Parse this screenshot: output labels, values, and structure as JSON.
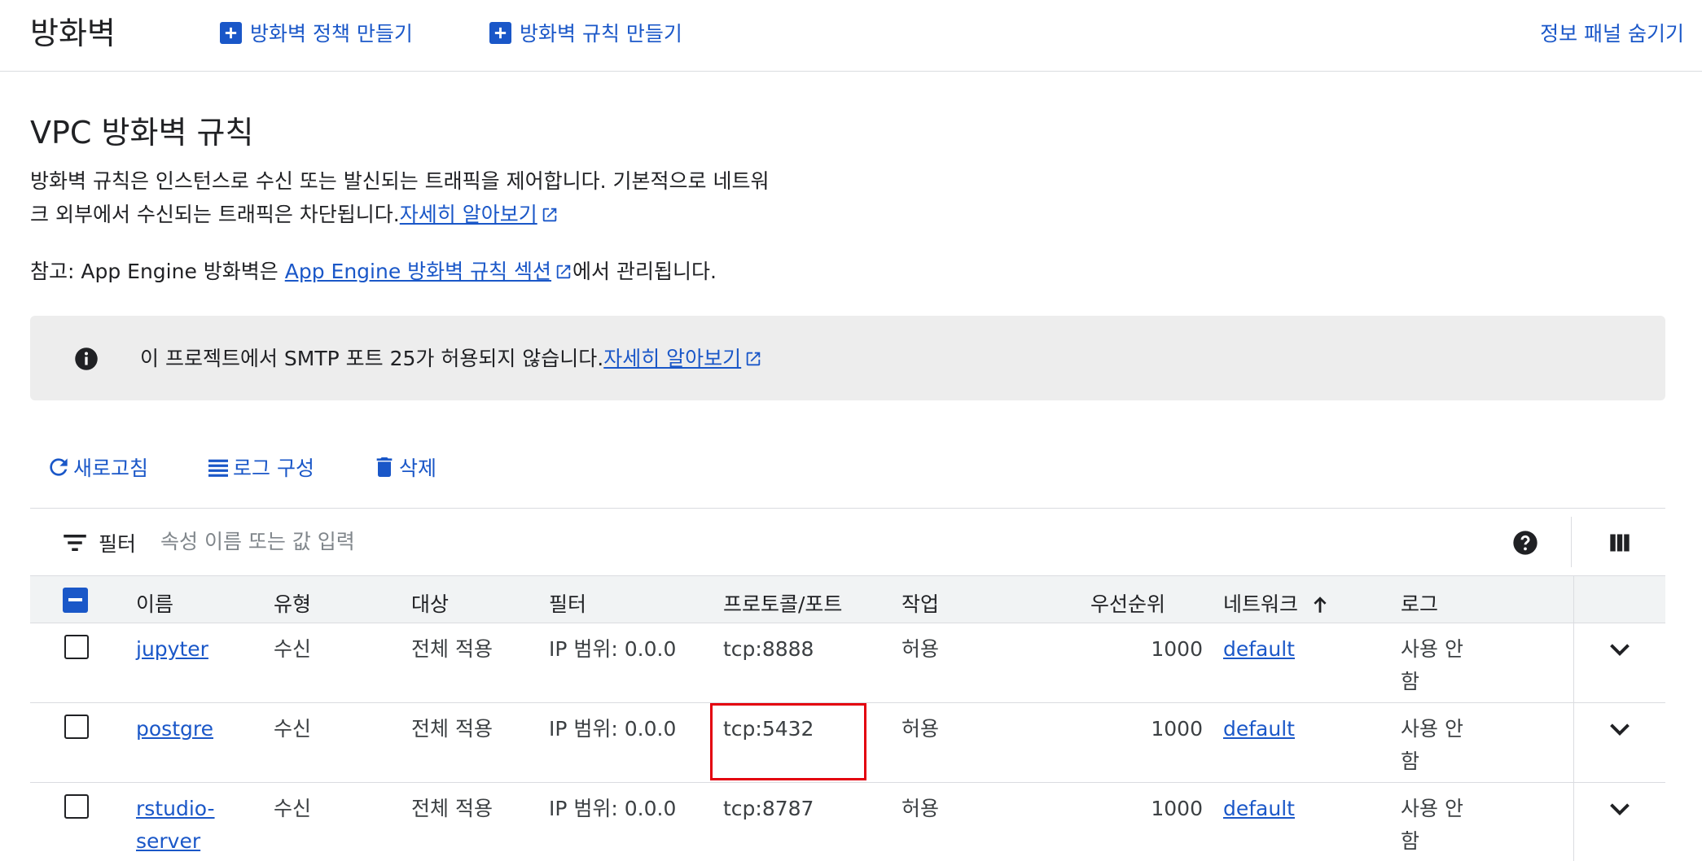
{
  "header": {
    "title": "방화벽",
    "create_policy_label": "방화벽 정책 만들기",
    "create_rule_label": "방화벽 규칙 만들기",
    "hide_panel_label": "정보 패널 숨기기"
  },
  "section": {
    "title": "VPC 방화벽 규칙",
    "description_line1": "방화벽 규칙은 인스턴스로 수신 또는 발신되는 트래픽을 제어합니다. 기본적으로 네트워",
    "description_line2": "크 외부에서 수신되는 트래픽은 차단됩니다.",
    "learn_more": "자세히 알아보기",
    "note_prefix": "참고: App Engine 방화벽은 ",
    "note_link": "App Engine 방화벽 규칙 섹션",
    "note_suffix": "에서 관리됩니다."
  },
  "banner": {
    "text": "이 프로젝트에서 SMTP 포트 25가 허용되지 않습니다.",
    "learn_more": "자세히 알아보기"
  },
  "toolbar": {
    "refresh_label": "새로고침",
    "log_config_label": "로그 구성",
    "delete_label": "삭제"
  },
  "filter": {
    "label": "필터",
    "placeholder": "속성 이름 또는 값 입력"
  },
  "table": {
    "columns": {
      "name": "이름",
      "type": "유형",
      "targets": "대상",
      "filters": "필터",
      "protocol_port": "프로토콜/포트",
      "action": "작업",
      "priority": "우선순위",
      "network": "네트워크",
      "logs": "로그"
    },
    "rows": [
      {
        "name_line1": "jupyter",
        "name_line2": "",
        "type": "수신",
        "targets": "전체 적용",
        "filters": "IP 범위: 0.0.0",
        "protocol_port": "tcp:8888",
        "action": "허용",
        "priority": "1000",
        "network": "default",
        "logs_line1": "사용 안",
        "logs_line2": "함"
      },
      {
        "name_line1": "postgre",
        "name_line2": "",
        "type": "수신",
        "targets": "전체 적용",
        "filters": "IP 범위: 0.0.0",
        "protocol_port": "tcp:5432",
        "action": "허용",
        "priority": "1000",
        "network": "default",
        "logs_line1": "사용 안",
        "logs_line2": "함"
      },
      {
        "name_line1": "rstudio-",
        "name_line2": "server",
        "type": "수신",
        "targets": "전체 적용",
        "filters": "IP 범위: 0.0.0",
        "protocol_port": "tcp:8787",
        "action": "허용",
        "priority": "1000",
        "network": "default",
        "logs_line1": "사용 안",
        "logs_line2": "함"
      }
    ]
  },
  "colors": {
    "accent": "#1a57c8",
    "highlight_box": "#e3000f",
    "banner_bg": "#ededed"
  }
}
